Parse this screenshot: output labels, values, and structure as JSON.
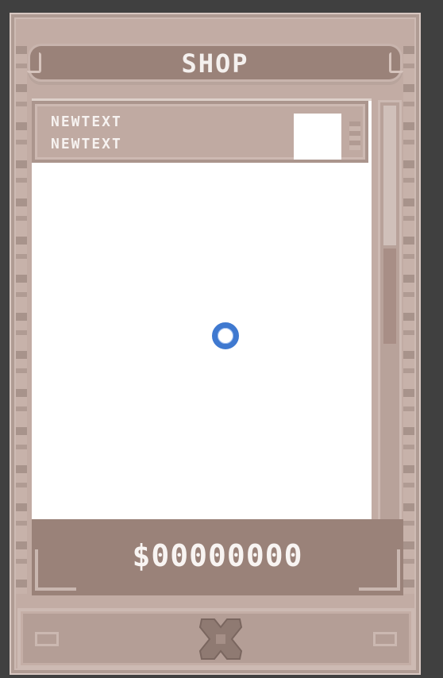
{
  "shop": {
    "title": "SHOP",
    "items": [
      {
        "line1": "NEWTEXT",
        "line2": "NEWTEXT"
      }
    ],
    "money": "$00000000",
    "loading": true
  },
  "colors": {
    "frame": "#c2aca4",
    "frame_dark": "#9a8279",
    "list_bg": "#ffffff",
    "text": "#f4f0ee",
    "spinner": "#3f79d0",
    "background": "#404040"
  },
  "icons": {
    "close": "close-x-icon",
    "loading": "loading-spinner-icon"
  }
}
